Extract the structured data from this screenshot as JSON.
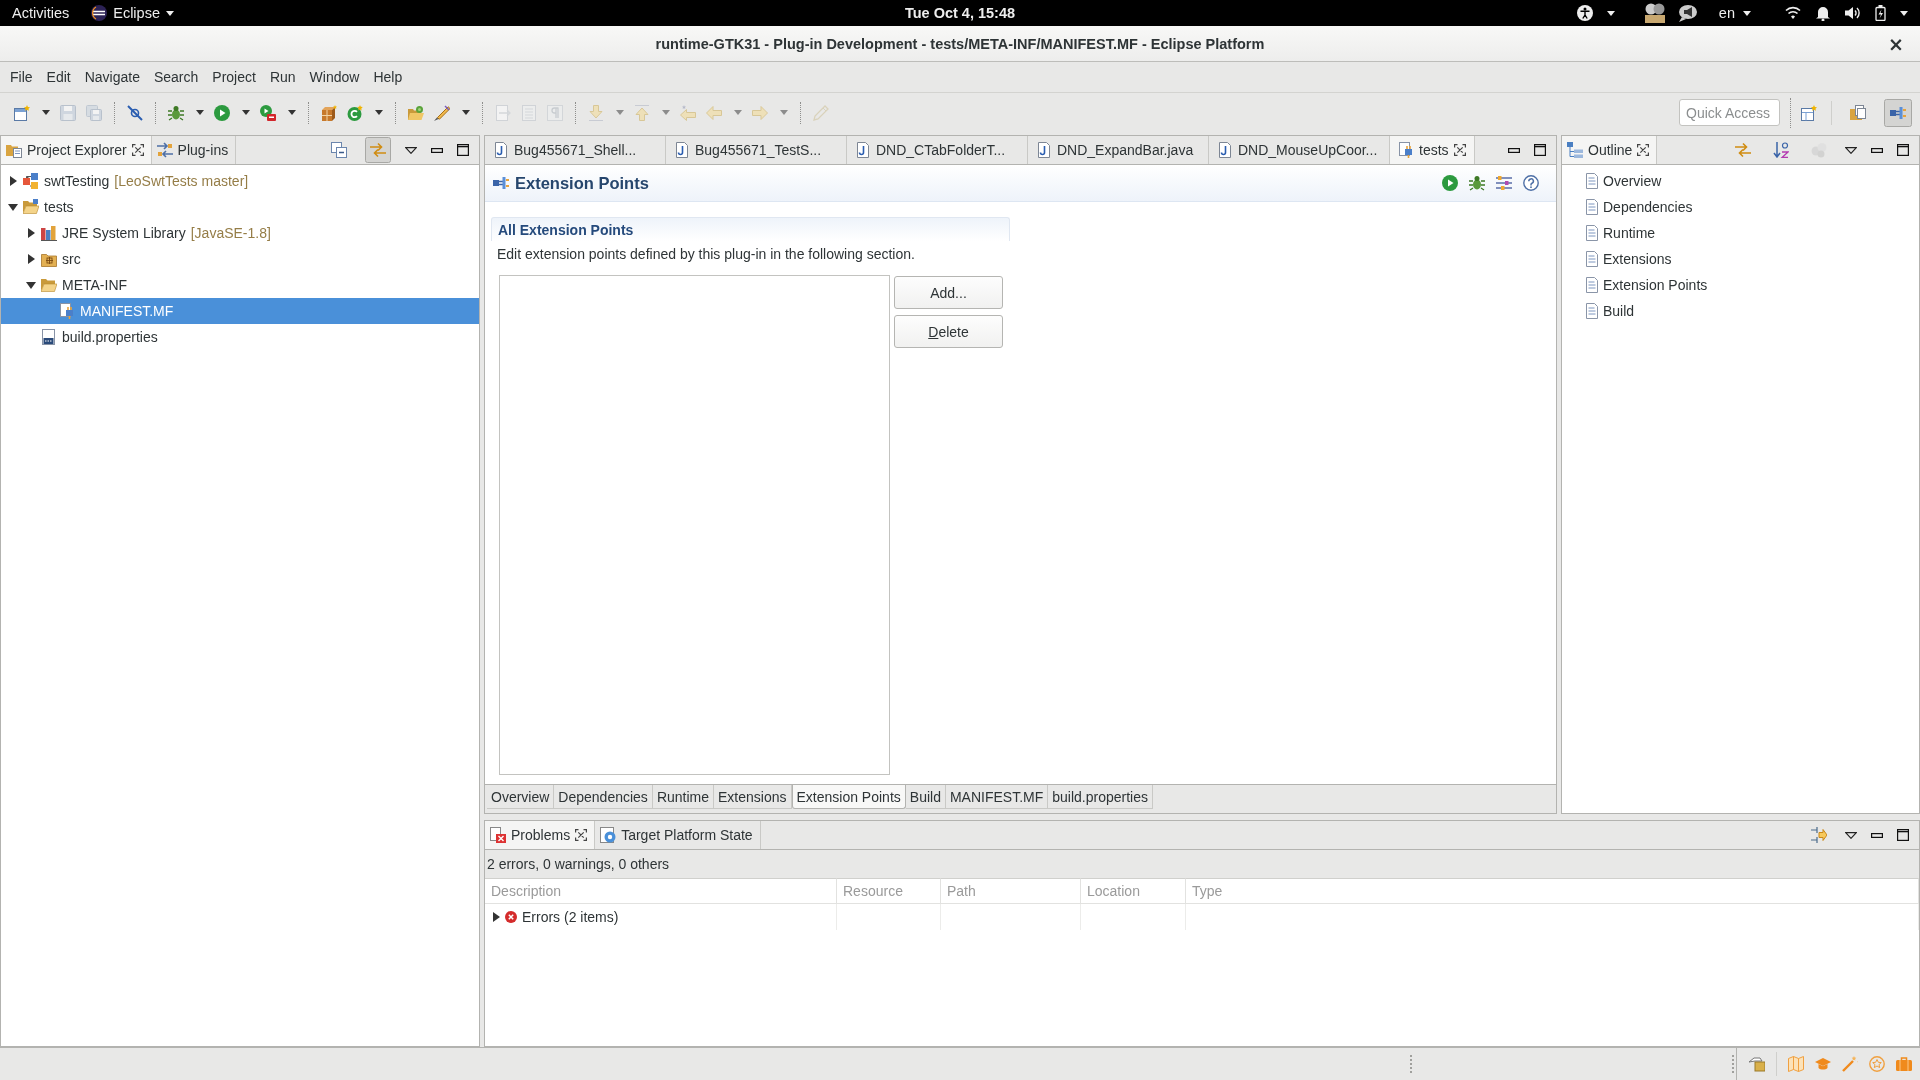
{
  "top_bar": {
    "activities": "Activities",
    "app_menu": "Eclipse",
    "clock": "Tue Oct  4, 15:48",
    "language": "en"
  },
  "window": {
    "title": "runtime-GTK31 - Plug-in Development - tests/META-INF/MANIFEST.MF - Eclipse Platform",
    "close": "×"
  },
  "menu_bar": [
    "File",
    "Edit",
    "Navigate",
    "Search",
    "Project",
    "Run",
    "Window",
    "Help"
  ],
  "toolbar": {
    "groups": [
      [
        {
          "kind": "new",
          "disabled": false,
          "dropdown": true
        },
        {
          "kind": "save",
          "disabled": true,
          "dropdown": false
        },
        {
          "kind": "save-all",
          "disabled": true,
          "dropdown": false
        }
      ],
      [
        {
          "kind": "skip",
          "disabled": false,
          "dropdown": false
        }
      ],
      [
        {
          "kind": "debug",
          "disabled": false,
          "dropdown": true
        },
        {
          "kind": "run",
          "disabled": false,
          "dropdown": true
        },
        {
          "kind": "external-tools",
          "disabled": false,
          "dropdown": true
        }
      ],
      [
        {
          "kind": "new-plugin",
          "disabled": false,
          "dropdown": false
        },
        {
          "kind": "refresh",
          "disabled": false,
          "dropdown": true
        }
      ],
      [
        {
          "kind": "open-folder",
          "disabled": false,
          "dropdown": false
        },
        {
          "kind": "marker",
          "disabled": false,
          "dropdown": true
        }
      ],
      [
        {
          "kind": "page-arrow",
          "disabled": true,
          "dropdown": false
        },
        {
          "kind": "page-lines",
          "disabled": true,
          "dropdown": false
        },
        {
          "kind": "pilcrow",
          "disabled": true,
          "dropdown": false
        }
      ],
      [
        {
          "kind": "next",
          "disabled": true,
          "dropdown": true
        },
        {
          "kind": "prev",
          "disabled": true,
          "dropdown": true
        },
        {
          "kind": "last-edit",
          "disabled": true,
          "dropdown": false
        },
        {
          "kind": "back",
          "disabled": true,
          "dropdown": true
        },
        {
          "kind": "forward",
          "disabled": true,
          "dropdown": true
        }
      ],
      [
        {
          "kind": "pen",
          "disabled": true,
          "dropdown": false
        }
      ]
    ],
    "quick_access": {
      "placeholder": "Quick Access"
    },
    "perspectives": [
      {
        "kind": "resource",
        "selected": false
      },
      {
        "kind": "plugin",
        "selected": true
      }
    ]
  },
  "project_explorer": {
    "tabs": [
      {
        "label": "Project Explorer",
        "kind": "explorer",
        "selected": true,
        "closable": true
      },
      {
        "label": "Plug-ins",
        "kind": "plugins",
        "selected": false,
        "closable": false
      }
    ],
    "actions": [
      {
        "kind": "collapse-all",
        "pressed": false,
        "disabled": false
      },
      {
        "kind": "link",
        "pressed": true,
        "disabled": false
      }
    ],
    "tree": [
      {
        "label": "swtTesting",
        "decoration": "[LeoSwtTests master]",
        "kind": "project",
        "expanded": false,
        "selected": false
      },
      {
        "label": "tests",
        "kind": "plugin-project",
        "expanded": true,
        "selected": false,
        "children": [
          {
            "label": "JRE System Library",
            "decoration": "[JavaSE-1.8]",
            "kind": "library",
            "expanded": false,
            "selected": false
          },
          {
            "label": "src",
            "kind": "source-folder",
            "expanded": false,
            "selected": false
          },
          {
            "label": "META-INF",
            "kind": "folder",
            "expanded": true,
            "selected": false,
            "children": [
              {
                "label": "MANIFEST.MF",
                "kind": "manifest",
                "selected": true
              }
            ]
          },
          {
            "label": "build.properties",
            "kind": "properties",
            "selected": false
          }
        ]
      }
    ]
  },
  "editor": {
    "tabs": [
      {
        "label": "Bug455671_Shell...",
        "kind": "java",
        "selected": false,
        "closable": false
      },
      {
        "label": "Bug455671_TestS...",
        "kind": "java",
        "selected": false,
        "closable": false
      },
      {
        "label": "DND_CTabFolderT...",
        "kind": "java",
        "selected": false,
        "closable": false
      },
      {
        "label": "DND_ExpandBar.java",
        "kind": "java",
        "selected": false,
        "closable": false
      },
      {
        "label": "DND_MouseUpCoor...",
        "kind": "java",
        "selected": false,
        "closable": false
      },
      {
        "label": "tests",
        "kind": "manifest",
        "selected": true,
        "closable": true
      }
    ],
    "page_title": "Extension Points",
    "section": {
      "title": "All Extension Points",
      "description": "Edit extension points defined by this plug-in in the following section."
    },
    "buttons": [
      {
        "label": "Add...",
        "underline_first": false
      },
      {
        "label": "Delete",
        "underline_first": true
      }
    ],
    "page_tabs": [
      {
        "label": "Overview",
        "selected": false
      },
      {
        "label": "Dependencies",
        "selected": false
      },
      {
        "label": "Runtime",
        "selected": false
      },
      {
        "label": "Extensions",
        "selected": false
      },
      {
        "label": "Extension Points",
        "selected": true
      },
      {
        "label": "Build",
        "selected": false
      },
      {
        "label": "MANIFEST.MF",
        "selected": false
      },
      {
        "label": "build.properties",
        "selected": false
      }
    ]
  },
  "outline": {
    "tabs": [
      {
        "label": "Outline",
        "kind": "outline",
        "selected": true,
        "closable": true
      }
    ],
    "actions": [
      {
        "kind": "link",
        "pressed": false,
        "disabled": false
      },
      {
        "kind": "sort",
        "pressed": false,
        "disabled": false
      },
      {
        "kind": "filter",
        "pressed": false,
        "disabled": true
      }
    ],
    "items": [
      "Overview",
      "Dependencies",
      "Runtime",
      "Extensions",
      "Extension Points",
      "Build"
    ]
  },
  "problems": {
    "tabs": [
      {
        "label": "Problems",
        "kind": "problems",
        "selected": true,
        "closable": true
      },
      {
        "label": "Target Platform State",
        "kind": "target",
        "selected": false,
        "closable": false
      }
    ],
    "actions": [
      {
        "kind": "focus",
        "pressed": false,
        "disabled": false
      }
    ],
    "summary": "2 errors, 0 warnings, 0 others",
    "columns": [
      "Description",
      "Resource",
      "Path",
      "Location",
      "Type"
    ],
    "rows": [
      {
        "description": "Errors (2 items)",
        "kind": "error",
        "expanded": false
      }
    ]
  }
}
